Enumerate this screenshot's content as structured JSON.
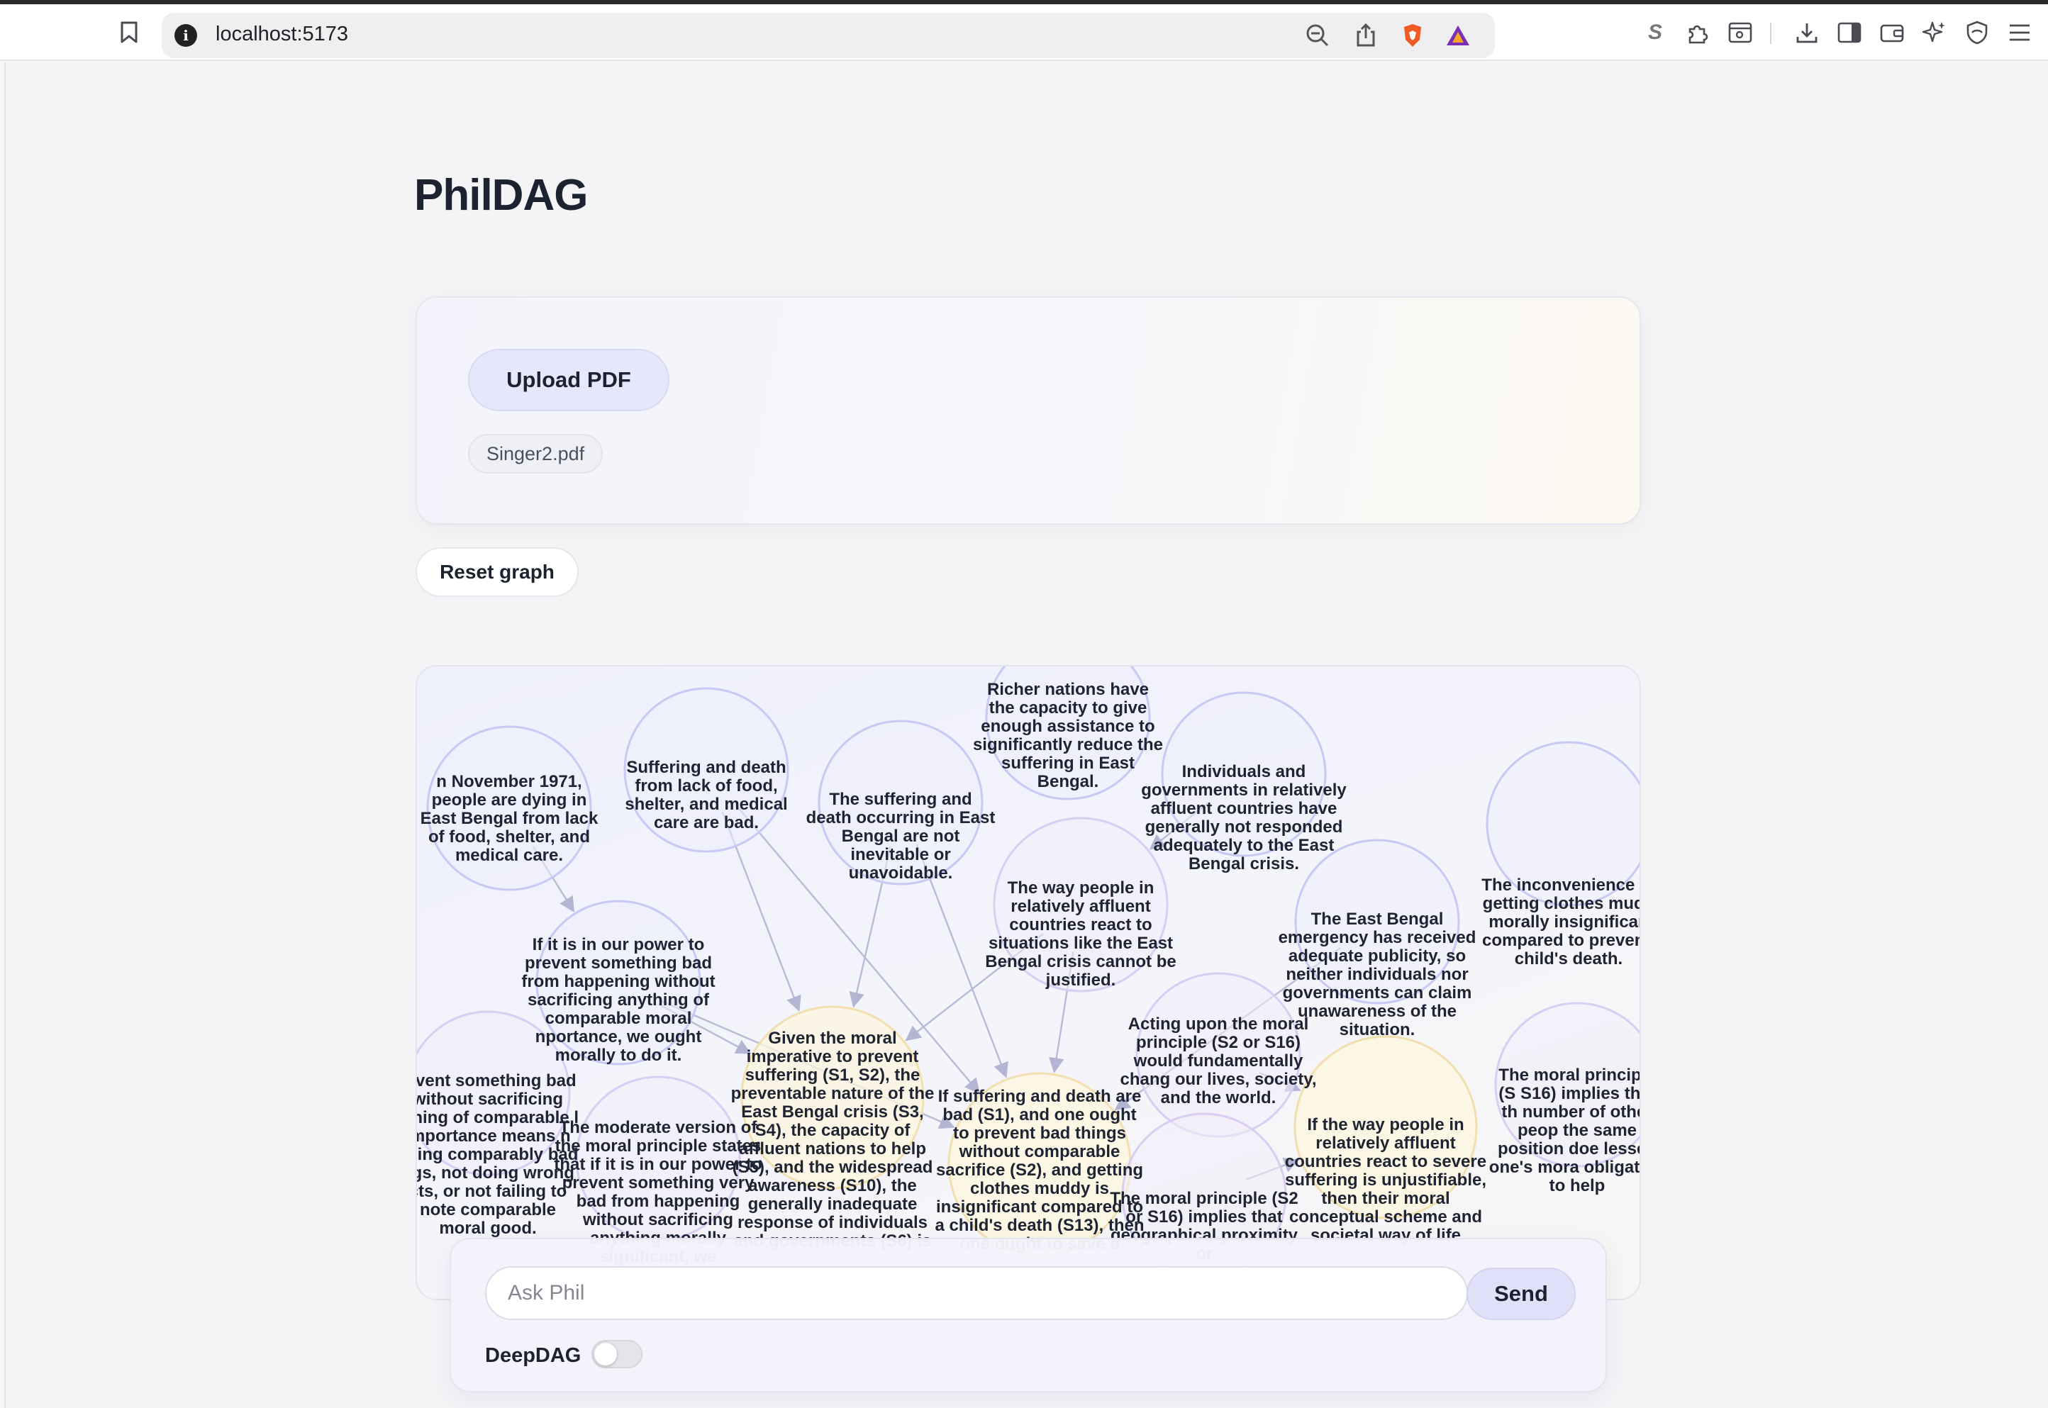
{
  "browser": {
    "url": "localhost:5173"
  },
  "app": {
    "title": "PhilDAG",
    "upload_label": "Upload PDF",
    "file_name": "Singer2.pdf",
    "reset_label": "Reset graph"
  },
  "graph": {
    "colors": {
      "premise": "#c7c9f4",
      "claim": "#d9cdf2",
      "conclusion": "#f2dfb0",
      "edge": "#b9bbd6"
    },
    "nodes": [
      {
        "id": "n1",
        "kind": "premise",
        "text": "n November 1971, people are dying in East Bengal from lack of food, shelter, and medical care."
      },
      {
        "id": "n2",
        "kind": "premise",
        "text": "Suffering and death from lack of food, shelter, and medical care are bad."
      },
      {
        "id": "n3",
        "kind": "premise",
        "text": "The suffering and death occurring in East Bengal are not inevitable or unavoidable."
      },
      {
        "id": "n4",
        "kind": "premise",
        "text": "Richer nations have the capacity to give enough assistance to significantly reduce the suffering in East Bengal."
      },
      {
        "id": "n5",
        "kind": "premise",
        "text": "Individuals and governments in relatively affluent countries have generally not responded adequately to the East Bengal crisis."
      },
      {
        "id": "n6",
        "kind": "premise",
        "text": "The inconvenience of getting clothes mudd morally insignifican compared to preventi child's death."
      },
      {
        "id": "n7",
        "kind": "premise",
        "text": "If it is in our power to prevent something bad from happening without sacrificing anything of comparable moral nportance, we ought morally to do it."
      },
      {
        "id": "n8",
        "kind": "claim",
        "text": "The way people in relatively affluent countries react to situations like the East Bengal crisis cannot be justified."
      },
      {
        "id": "n9",
        "kind": "premise",
        "text": "The East Bengal emergency has received adequate publicity, so neither individuals nor governments can claim unawareness of the situation."
      },
      {
        "id": "n10",
        "kind": "conclusion",
        "text": "Given the moral imperative to prevent suffering (S1, S2), the preventable nature of the East Bengal crisis (S3, S4), the capacity of affluent nations to help (S5), and the widespread awareness (S10), the generally inadequate response of individuals and governments (S6) is"
      },
      {
        "id": "n11",
        "kind": "claim",
        "text": "Acting upon the moral principle (S2 or S16) would fundamentally chang our lives, society, and the world."
      },
      {
        "id": "n12",
        "kind": "claim",
        "text": "revent something bad without sacrificing ything of comparable l importance means n using comparably bad ngs, not doing wrong cts, or not failing to note comparable moral good."
      },
      {
        "id": "n13",
        "kind": "claim",
        "text": "The moderate version of the moral principle states that if it is in our power to prevent something very bad from happening without sacrificing anything morally significant, we"
      },
      {
        "id": "n14",
        "kind": "conclusion",
        "text": "If suffering and death are bad (S1), and one ought to prevent bad things without comparable sacrifice (S2), and getting clothes muddy is insignificant compared to a child's death (S13), then one ought to save a"
      },
      {
        "id": "n15",
        "kind": "claim",
        "text": "The moral principle (S2 or S16) implies that geographical proximity or"
      },
      {
        "id": "n16",
        "kind": "conclusion",
        "text": "If the way people in relatively affluent countries react to severe suffering is unjustifiable, then their moral conceptual scheme and societal way of life"
      },
      {
        "id": "n17",
        "kind": "claim",
        "text": "The moral principle (S S16) implies that th number of other peop the same position doe lessen one's mora obligation to help"
      }
    ]
  },
  "chat": {
    "placeholder": "Ask Phil",
    "send_label": "Send",
    "deepdag_label": "DeepDAG",
    "deepdag_enabled": false
  }
}
